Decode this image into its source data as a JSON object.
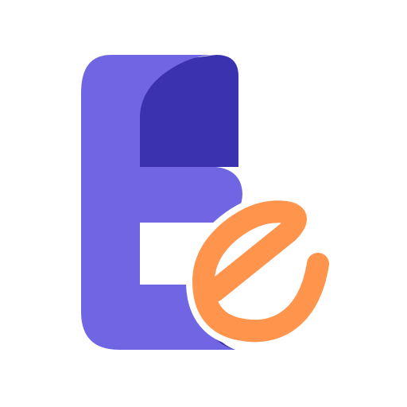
{
  "logo": {
    "icon": "letter-e-logo-icon",
    "colors": {
      "background": "#ffffff",
      "primary_purple": "#7066E3",
      "dark_indigo": "#3A32AE",
      "accent_orange": "#FF944D"
    }
  }
}
